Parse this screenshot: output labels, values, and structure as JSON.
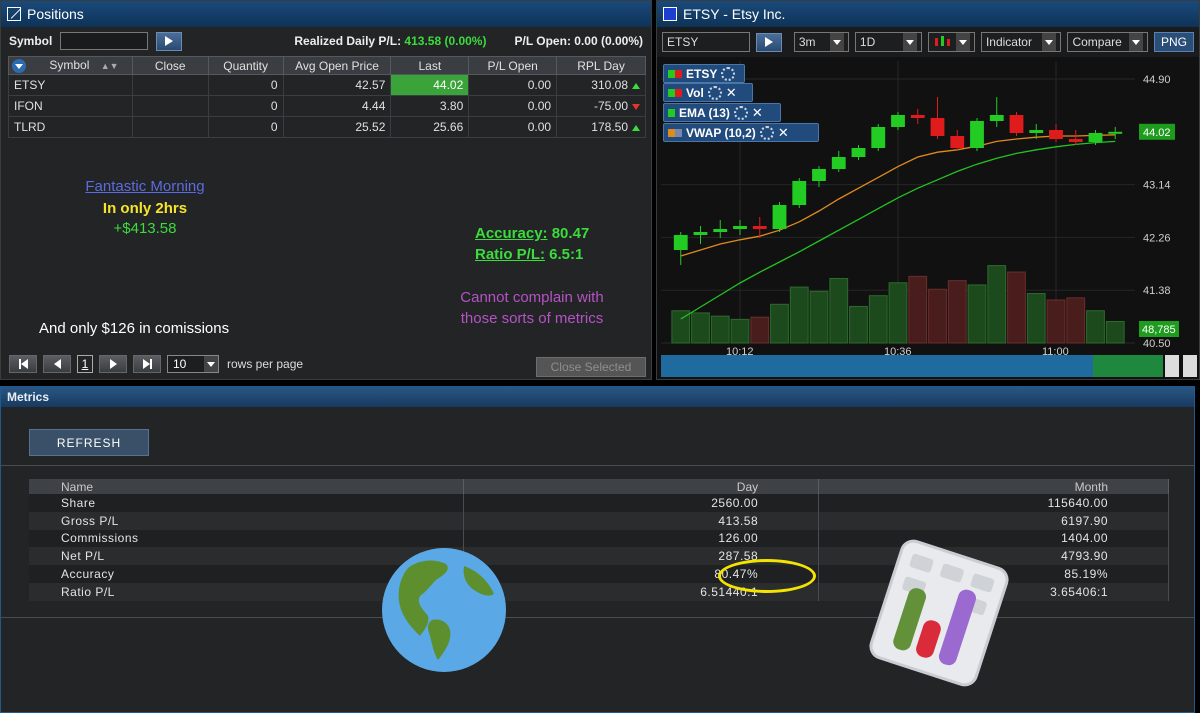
{
  "positions": {
    "title": "Positions",
    "symbol_label": "Symbol",
    "symbol_value": "",
    "realized_label": "Realized Daily P/L:",
    "realized_value": "413.58 (0.00%)",
    "pl_open_label": "P/L Open:",
    "pl_open_value": "0.00 (0.00%)",
    "columns": [
      "Symbol",
      "Close",
      "Quantity",
      "Avg Open Price",
      "Last",
      "P/L Open",
      "RPL Day"
    ],
    "rows": [
      {
        "symbol": "ETSY",
        "close": "",
        "quantity": "0",
        "avg_open": "42.57",
        "last": "44.02",
        "pl_open": "0.00",
        "rpl_day": "310.08",
        "dir": "up"
      },
      {
        "symbol": "IFON",
        "close": "",
        "quantity": "0",
        "avg_open": "4.44",
        "last": "3.80",
        "pl_open": "0.00",
        "rpl_day": "-75.00",
        "dir": "down"
      },
      {
        "symbol": "TLRD",
        "close": "",
        "quantity": "0",
        "avg_open": "25.52",
        "last": "25.66",
        "pl_open": "0.00",
        "rpl_day": "178.50",
        "dir": "up"
      }
    ],
    "page_number": "1",
    "rows_per_page": "10",
    "rows_per_page_label": "rows per page",
    "close_selected": "Close Selected"
  },
  "annotations": {
    "fantastic": "Fantastic Morning",
    "in_only": "In only 2hrs",
    "amount": "+$413.58",
    "accuracy_label": "Accuracy:",
    "accuracy_value": "80.47",
    "ratio_label": "Ratio P/L:",
    "ratio_value": "6.5:1",
    "complain": "Cannot complain with those sorts of metrics",
    "commissions": "And only $126 in comissions"
  },
  "chart": {
    "title": "ETSY - Etsy Inc.",
    "symbol": "ETSY",
    "interval": "3m",
    "range": "1D",
    "indicator": "Indicator",
    "compare": "Compare",
    "png": "PNG",
    "tags": [
      "ETSY",
      "Vol",
      "EMA (13)",
      "VWAP (10,2)"
    ],
    "colors": {
      "up": "#22cc22",
      "down": "#e01b1b",
      "ema": "#e08a1e",
      "vwap": "#22c322"
    }
  },
  "chart_data": {
    "type": "candlestick",
    "yticks": [
      44.9,
      43.14,
      42.26,
      41.38,
      40.5
    ],
    "ytick_labels": [
      "44.90",
      "43.14",
      "42.26",
      "41.38",
      "40.50"
    ],
    "xtick_labels": [
      "10:12",
      "10:36",
      "11:00"
    ],
    "xtick_index": [
      3,
      11,
      19
    ],
    "last_price_label": "44.02",
    "last_volume_label": "48,785",
    "ylim": [
      40.5,
      45.2
    ],
    "candles": [
      {
        "o": 42.05,
        "h": 42.35,
        "l": 41.8,
        "c": 42.3
      },
      {
        "o": 42.3,
        "h": 42.45,
        "l": 42.15,
        "c": 42.35
      },
      {
        "o": 42.35,
        "h": 42.55,
        "l": 42.25,
        "c": 42.4
      },
      {
        "o": 42.4,
        "h": 42.55,
        "l": 42.3,
        "c": 42.45
      },
      {
        "o": 42.45,
        "h": 42.6,
        "l": 42.25,
        "c": 42.4
      },
      {
        "o": 42.4,
        "h": 42.85,
        "l": 42.35,
        "c": 42.8
      },
      {
        "o": 42.8,
        "h": 43.25,
        "l": 42.75,
        "c": 43.2
      },
      {
        "o": 43.2,
        "h": 43.45,
        "l": 43.1,
        "c": 43.4
      },
      {
        "o": 43.4,
        "h": 43.7,
        "l": 43.35,
        "c": 43.6
      },
      {
        "o": 43.6,
        "h": 43.8,
        "l": 43.55,
        "c": 43.75
      },
      {
        "o": 43.75,
        "h": 44.15,
        "l": 43.7,
        "c": 44.1
      },
      {
        "o": 44.1,
        "h": 44.35,
        "l": 44.05,
        "c": 44.3
      },
      {
        "o": 44.3,
        "h": 44.4,
        "l": 44.15,
        "c": 44.25
      },
      {
        "o": 44.25,
        "h": 44.6,
        "l": 43.9,
        "c": 43.95
      },
      {
        "o": 43.95,
        "h": 44.05,
        "l": 43.7,
        "c": 43.75
      },
      {
        "o": 43.75,
        "h": 44.25,
        "l": 43.7,
        "c": 44.2
      },
      {
        "o": 44.2,
        "h": 44.6,
        "l": 44.1,
        "c": 44.3
      },
      {
        "o": 44.3,
        "h": 44.35,
        "l": 43.95,
        "c": 44.0
      },
      {
        "o": 44.0,
        "h": 44.15,
        "l": 43.9,
        "c": 44.05
      },
      {
        "o": 44.05,
        "h": 44.15,
        "l": 43.85,
        "c": 43.9
      },
      {
        "o": 43.9,
        "h": 44.05,
        "l": 43.8,
        "c": 43.85
      },
      {
        "o": 43.85,
        "h": 44.05,
        "l": 43.8,
        "c": 44.0
      },
      {
        "o": 44.0,
        "h": 44.1,
        "l": 43.9,
        "c": 44.02
      }
    ],
    "volume": [
      30,
      28,
      25,
      22,
      24,
      36,
      52,
      48,
      60,
      34,
      44,
      56,
      62,
      50,
      58,
      54,
      72,
      66,
      46,
      40,
      42,
      30,
      20
    ],
    "ema": [
      41.95,
      42.05,
      42.15,
      42.22,
      42.28,
      42.38,
      42.52,
      42.7,
      42.9,
      43.08,
      43.26,
      43.44,
      43.6,
      43.68,
      43.72,
      43.78,
      43.86,
      43.9,
      43.93,
      43.95,
      43.95,
      43.96,
      43.97
    ],
    "vwap": [
      40.9,
      41.1,
      41.3,
      41.5,
      41.68,
      41.85,
      42.02,
      42.2,
      42.38,
      42.56,
      42.74,
      42.92,
      43.08,
      43.22,
      43.36,
      43.48,
      43.58,
      43.66,
      43.72,
      43.77,
      43.81,
      43.84,
      43.86
    ]
  },
  "metrics": {
    "title": "Metrics",
    "refresh": "REFRESH",
    "columns": [
      "Name",
      "Day",
      "Month"
    ],
    "rows": [
      {
        "name": "Share",
        "day": "2560.00",
        "month": "115640.00"
      },
      {
        "name": "Gross P/L",
        "day": "413.58",
        "month": "6197.90"
      },
      {
        "name": "Commissions",
        "day": "126.00",
        "month": "1404.00"
      },
      {
        "name": "Net P/L",
        "day": "287.58",
        "month": "4793.90"
      },
      {
        "name": "Accuracy",
        "day": "80.47%",
        "month": "85.19%"
      },
      {
        "name": "Ratio P/L",
        "day": "6.51440:1",
        "month": "3.65406:1"
      }
    ]
  }
}
